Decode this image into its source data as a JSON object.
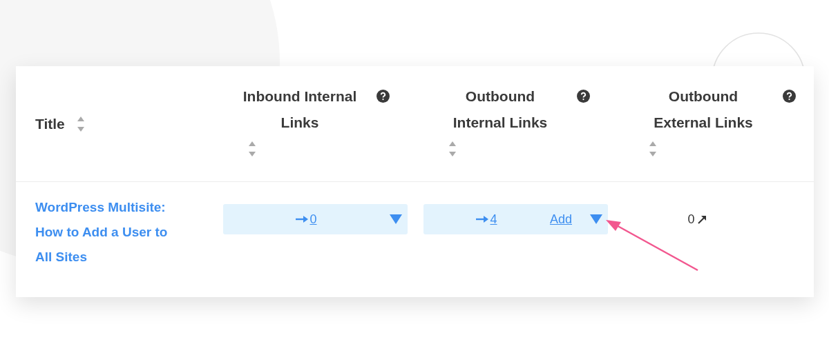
{
  "table": {
    "columns": [
      {
        "label": "Title",
        "help": false
      },
      {
        "label": "Inbound Internal Links",
        "help": true
      },
      {
        "label": "Outbound Internal Links",
        "help": true
      },
      {
        "label": "Outbound External Links",
        "help": true
      }
    ],
    "rows": [
      {
        "title": "WordPress Multisite: How to Add a User to All Sites",
        "inbound": {
          "count": "0"
        },
        "outbound_internal": {
          "count": "4",
          "add": "Add"
        },
        "outbound_external": {
          "count": "0"
        }
      }
    ]
  }
}
